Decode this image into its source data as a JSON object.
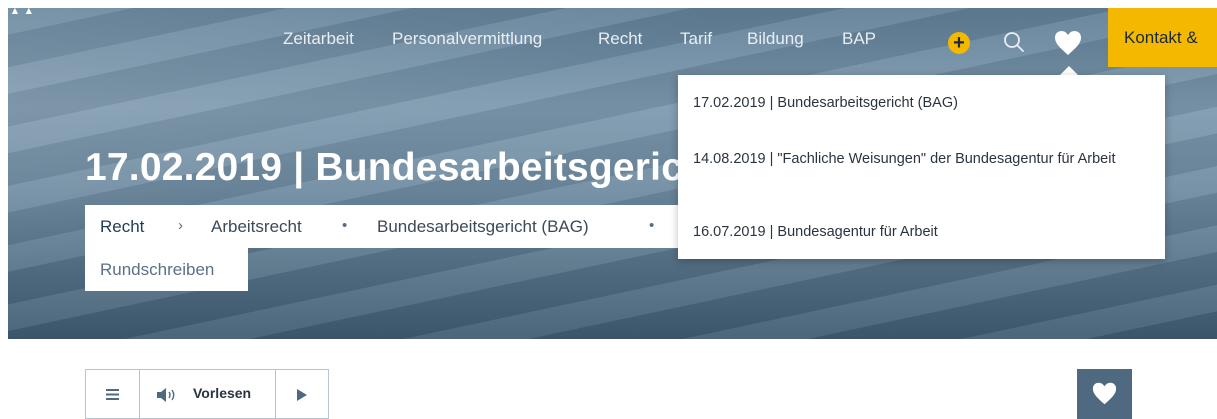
{
  "nav": {
    "items": [
      "Zeitarbeit",
      "Personalvermittlung",
      "Recht",
      "Tarif",
      "Bildung",
      "BAP"
    ],
    "plus_symbol": "+",
    "contact_label": "Kontakt &",
    "icons": [
      "plus-icon",
      "search-icon",
      "heart-icon"
    ]
  },
  "page": {
    "title": "17.02.2019 | Bundesarbeitsgeric"
  },
  "breadcrumb": {
    "items": [
      "Recht",
      "Arbeitsrecht",
      "Bundesarbeitsgericht (BAG)",
      "Rundschreiben"
    ],
    "separators": [
      "›",
      "•",
      "•"
    ]
  },
  "favorites_dropdown": {
    "items": [
      "17.02.2019 | Bundesarbeitsgericht (BAG)",
      "14.08.2019 | \"Fachliche Weisungen\" der Bundesagentur für Arbeit",
      "16.07.2019 | Bundesagentur für Arbeit"
    ]
  },
  "toolbar": {
    "menu_icon": "menu-icon",
    "speaker_icon": "speaker-icon",
    "read_aloud_label": "Vorlesen",
    "play_icon": "play-icon"
  },
  "favorite_button": {
    "icon": "heart-icon"
  },
  "colors": {
    "accent": "#f5b800",
    "link": "#1f3b57",
    "hero_dark": "#3e5a70",
    "favorite_button": "#4f6a80"
  }
}
